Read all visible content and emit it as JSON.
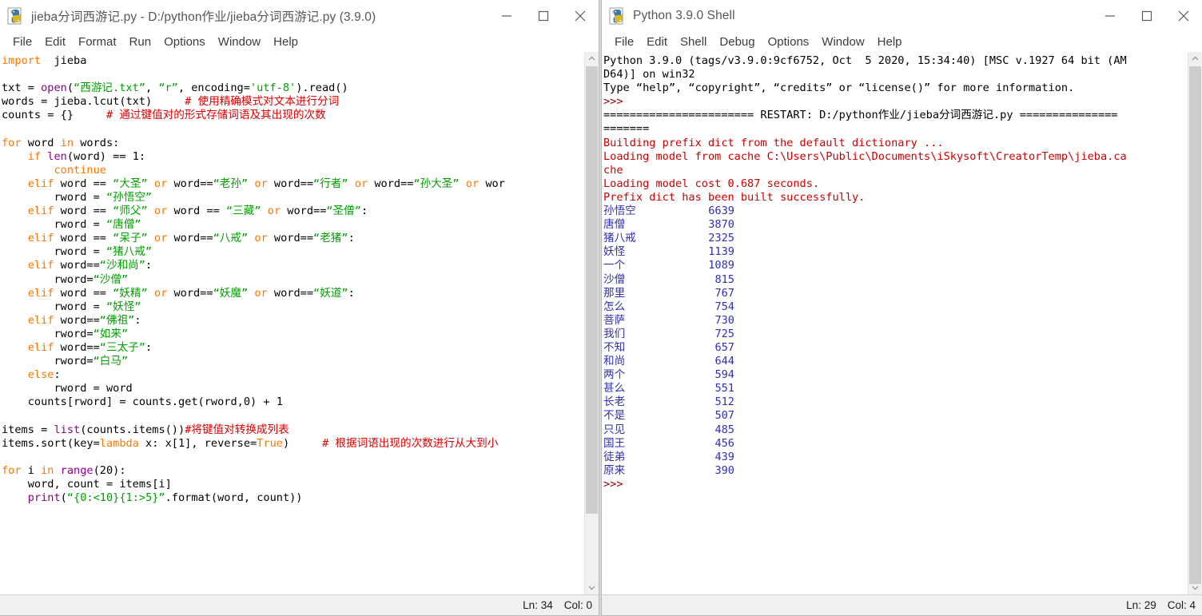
{
  "editor": {
    "title": "jieba分词西游记.py - D:/python作业/jieba分词西游记.py (3.9.0)",
    "icon": "python-idle-icon",
    "menus": [
      "File",
      "Edit",
      "Format",
      "Run",
      "Options",
      "Window",
      "Help"
    ],
    "window_controls": {
      "minimize": "minimize-icon",
      "maximize": "maximize-icon",
      "close": "close-icon"
    },
    "status": {
      "line": "Ln: 34",
      "column": "Col: 0"
    },
    "code_lines": [
      [
        [
          "kw",
          "import"
        ],
        [
          "",
          "  jieba"
        ]
      ],
      [
        [
          "",
          ""
        ]
      ],
      [
        [
          "",
          "txt = "
        ],
        [
          "bi",
          "open"
        ],
        [
          "",
          "("
        ],
        [
          "str",
          "“西游记.txt”"
        ],
        [
          "",
          ", "
        ],
        [
          "str",
          "“r”"
        ],
        [
          "",
          ", encoding="
        ],
        [
          "str",
          "'utf-8'"
        ],
        [
          "",
          ").read()"
        ]
      ],
      [
        [
          "",
          "words = jieba.lcut(txt)     "
        ],
        [
          "cmt",
          "# 使用精确模式对文本进行分词"
        ]
      ],
      [
        [
          "",
          "counts = {}     "
        ],
        [
          "cmt",
          "# 通过键值对的形式存储词语及其出现的次数"
        ]
      ],
      [
        [
          "",
          ""
        ]
      ],
      [
        [
          "kw",
          "for"
        ],
        [
          "",
          " word "
        ],
        [
          "kw",
          "in"
        ],
        [
          "",
          " words:"
        ]
      ],
      [
        [
          "",
          "    "
        ],
        [
          "kw",
          "if"
        ],
        [
          "bi",
          " len"
        ],
        [
          "",
          "(word) == 1:"
        ]
      ],
      [
        [
          "",
          "        "
        ],
        [
          "kw",
          "continue"
        ]
      ],
      [
        [
          "",
          "    "
        ],
        [
          "kw",
          "elif"
        ],
        [
          "",
          " word == "
        ],
        [
          "str",
          "“大圣”"
        ],
        [
          "kw",
          " or"
        ],
        [
          "",
          " word=="
        ],
        [
          "str",
          "“老孙”"
        ],
        [
          "kw",
          " or"
        ],
        [
          "",
          " word=="
        ],
        [
          "str",
          "“行者”"
        ],
        [
          "kw",
          " or"
        ],
        [
          "",
          " word=="
        ],
        [
          "str",
          "“孙大圣”"
        ],
        [
          "kw",
          " or"
        ],
        [
          "",
          " wor"
        ]
      ],
      [
        [
          "",
          "        rword = "
        ],
        [
          "str",
          "“孙悟空”"
        ]
      ],
      [
        [
          "",
          "    "
        ],
        [
          "kw",
          "elif"
        ],
        [
          "",
          " word == "
        ],
        [
          "str",
          "“师父”"
        ],
        [
          "kw",
          " or"
        ],
        [
          "",
          " word == "
        ],
        [
          "str",
          "“三藏”"
        ],
        [
          "kw",
          " or"
        ],
        [
          "",
          " word=="
        ],
        [
          "str",
          "“圣僧”"
        ],
        [
          "",
          ":"
        ]
      ],
      [
        [
          "",
          "        rword = "
        ],
        [
          "str",
          "“唐僧”"
        ]
      ],
      [
        [
          "",
          "    "
        ],
        [
          "kw",
          "elif"
        ],
        [
          "",
          " word == "
        ],
        [
          "str",
          "“呆子”"
        ],
        [
          "kw",
          " or"
        ],
        [
          "",
          " word=="
        ],
        [
          "str",
          "“八戒”"
        ],
        [
          "kw",
          " or"
        ],
        [
          "",
          " word=="
        ],
        [
          "str",
          "“老猪”"
        ],
        [
          "",
          ":"
        ]
      ],
      [
        [
          "",
          "        rword = "
        ],
        [
          "str",
          "“猪八戒”"
        ]
      ],
      [
        [
          "",
          "    "
        ],
        [
          "kw",
          "elif"
        ],
        [
          "",
          " word=="
        ],
        [
          "str",
          "“沙和尚”"
        ],
        [
          "",
          ":"
        ]
      ],
      [
        [
          "",
          "        rword="
        ],
        [
          "str",
          "“沙僧”"
        ]
      ],
      [
        [
          "",
          "    "
        ],
        [
          "kw",
          "elif"
        ],
        [
          "",
          " word == "
        ],
        [
          "str",
          "“妖精”"
        ],
        [
          "kw",
          " or"
        ],
        [
          "",
          " word=="
        ],
        [
          "str",
          "“妖魔”"
        ],
        [
          "kw",
          " or"
        ],
        [
          "",
          " word=="
        ],
        [
          "str",
          "“妖道”"
        ],
        [
          "",
          ":"
        ]
      ],
      [
        [
          "",
          "        rword = "
        ],
        [
          "str",
          "“妖怪”"
        ]
      ],
      [
        [
          "",
          "    "
        ],
        [
          "kw",
          "elif"
        ],
        [
          "",
          " word=="
        ],
        [
          "str",
          "“佛祖”"
        ],
        [
          "",
          ":"
        ]
      ],
      [
        [
          "",
          "        rword="
        ],
        [
          "str",
          "“如来”"
        ]
      ],
      [
        [
          "",
          "    "
        ],
        [
          "kw",
          "elif"
        ],
        [
          "",
          " word=="
        ],
        [
          "str",
          "“三太子”"
        ],
        [
          "",
          ":"
        ]
      ],
      [
        [
          "",
          "        rword="
        ],
        [
          "str",
          "“白马”"
        ]
      ],
      [
        [
          "",
          "    "
        ],
        [
          "kw",
          "else"
        ],
        [
          "",
          ":"
        ]
      ],
      [
        [
          "",
          "        rword = word"
        ]
      ],
      [
        [
          "",
          "    counts[rword] = counts.get(rword,0) + 1"
        ]
      ],
      [
        [
          "",
          ""
        ]
      ],
      [
        [
          "",
          "items = "
        ],
        [
          "bi",
          "list"
        ],
        [
          "",
          "(counts.items())"
        ],
        [
          "cmt",
          "#将键值对转换成列表"
        ]
      ],
      [
        [
          "",
          "items.sort(key="
        ],
        [
          "kw",
          "lambda"
        ],
        [
          "",
          " x: x[1], reverse="
        ],
        [
          "kw",
          "True"
        ],
        [
          "",
          ")     "
        ],
        [
          "cmt",
          "# 根据词语出现的次数进行从大到小"
        ]
      ],
      [
        [
          "",
          ""
        ]
      ],
      [
        [
          "kw",
          "for"
        ],
        [
          "",
          " i "
        ],
        [
          "kw",
          "in"
        ],
        [
          "bi",
          " range"
        ],
        [
          "",
          "(20):"
        ]
      ],
      [
        [
          "",
          "    word, count = items[i]"
        ]
      ],
      [
        [
          "",
          "    "
        ],
        [
          "bi",
          "print"
        ],
        [
          "",
          "("
        ],
        [
          "str",
          "“{0:<10}{1:>5}”"
        ],
        [
          "",
          ".format(word, count))"
        ]
      ]
    ]
  },
  "shell": {
    "title": "Python 3.9.0 Shell",
    "icon": "python-idle-icon",
    "menus": [
      "File",
      "Edit",
      "Shell",
      "Debug",
      "Options",
      "Window",
      "Help"
    ],
    "window_controls": {
      "minimize": "minimize-icon",
      "maximize": "maximize-icon",
      "close": "close-icon"
    },
    "status": {
      "line": "Ln: 29",
      "column": "Col: 4"
    },
    "banner": [
      "Python 3.9.0 (tags/v3.9.0:9cf6752, Oct  5 2020, 15:34:40) [MSC v.1927 64 bit (AM",
      "D64)] on win32",
      "Type “help”, “copyright”, “credits” or “license()” for more information."
    ],
    "prompt": ">>>",
    "restart_line_1": "======================= RESTART: D:/python作业/jieba分词西游记.py ===============",
    "restart_line_2": "=======",
    "jieba_messages": [
      "Building prefix dict from the default dictionary ...",
      "Loading model from cache C:\\Users\\Public\\Documents\\iSkysoft\\CreatorTemp\\jieba.ca",
      "che",
      "Loading model cost 0.687 seconds.",
      "Prefix dict has been built successfully."
    ],
    "final_prompt": ">>>",
    "word_counts": [
      {
        "word": "孙悟空",
        "count": "6639"
      },
      {
        "word": "唐僧",
        "count": "3870"
      },
      {
        "word": "猪八戒",
        "count": "2325"
      },
      {
        "word": "妖怪",
        "count": "1139"
      },
      {
        "word": "一个",
        "count": "1089"
      },
      {
        "word": "沙僧",
        "count": "815"
      },
      {
        "word": "那里",
        "count": "767"
      },
      {
        "word": "怎么",
        "count": "754"
      },
      {
        "word": "菩萨",
        "count": "730"
      },
      {
        "word": "我们",
        "count": "725"
      },
      {
        "word": "不知",
        "count": "657"
      },
      {
        "word": "和尚",
        "count": "644"
      },
      {
        "word": "两个",
        "count": "594"
      },
      {
        "word": "甚么",
        "count": "551"
      },
      {
        "word": "长老",
        "count": "512"
      },
      {
        "word": "不是",
        "count": "507"
      },
      {
        "word": "只见",
        "count": "485"
      },
      {
        "word": "国王",
        "count": "456"
      },
      {
        "word": "徒弟",
        "count": "439"
      },
      {
        "word": "原来",
        "count": "390"
      }
    ]
  },
  "colors": {
    "keyword": "#FF7700",
    "string": "#00A000",
    "builtin": "#900090",
    "comment": "#DD0000",
    "shell_error": "#CC0000",
    "shell_output": "#3030B0"
  }
}
